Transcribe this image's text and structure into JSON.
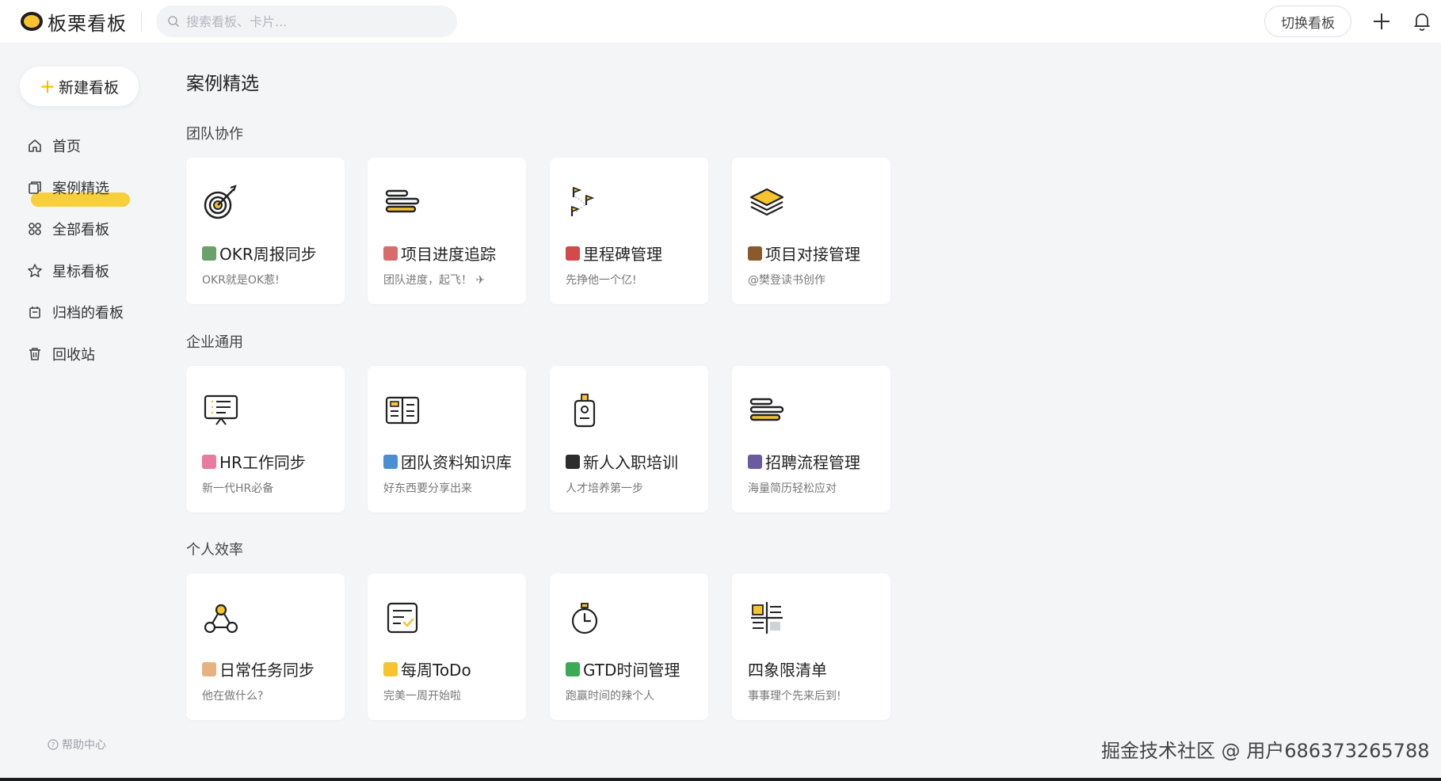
{
  "app": {
    "name": "板栗看板"
  },
  "search": {
    "placeholder": "搜索看板、卡片..."
  },
  "header": {
    "switch_board_label": "切换看板"
  },
  "sidebar": {
    "new_board_label": "新建看板",
    "items": [
      {
        "label": "首页",
        "icon": "home-icon"
      },
      {
        "label": "案例精选",
        "icon": "copy-icon",
        "active": true
      },
      {
        "label": "全部看板",
        "icon": "grid-icon"
      },
      {
        "label": "星标看板",
        "icon": "star-icon"
      },
      {
        "label": "归档的看板",
        "icon": "archive-icon"
      },
      {
        "label": "回收站",
        "icon": "trash-icon"
      }
    ],
    "help_label": "帮助中心"
  },
  "main": {
    "title": "案例精选",
    "sections": [
      {
        "title": "团队协作",
        "cards": [
          {
            "title": "OKR周报同步",
            "desc": "OKR就是OK惹!",
            "icon": "target-icon"
          },
          {
            "title": "项目进度追踪",
            "desc": "团队进度，起飞！ ✈",
            "icon": "progress-bars-icon"
          },
          {
            "title": "里程碑管理",
            "desc": "先挣他一个亿!",
            "icon": "milestone-flags-icon"
          },
          {
            "title": "项目对接管理",
            "desc": "@樊登读书创作",
            "icon": "layers-icon"
          }
        ]
      },
      {
        "title": "企业通用",
        "cards": [
          {
            "title": "HR工作同步",
            "desc": "新一代HR必备",
            "icon": "presentation-board-icon"
          },
          {
            "title": "团队资料知识库",
            "desc": "好东西要分享出来",
            "icon": "book-icon"
          },
          {
            "title": "新人入职培训",
            "desc": "人才培养第一步",
            "icon": "badge-icon"
          },
          {
            "title": "招聘流程管理",
            "desc": "海量简历轻松应对",
            "icon": "list-bars-icon"
          }
        ]
      },
      {
        "title": "个人效率",
        "cards": [
          {
            "title": "日常任务同步",
            "desc": "他在做什么?",
            "icon": "network-triangle-icon"
          },
          {
            "title": "每周ToDo",
            "desc": "完美一周开始啦",
            "icon": "checklist-icon"
          },
          {
            "title": "GTD时间管理",
            "desc": "跑赢时间的辣个人",
            "icon": "stopwatch-icon"
          },
          {
            "title": "四象限清单",
            "desc": "事事理个先来后到!",
            "icon": "quadrant-icon"
          }
        ]
      }
    ]
  },
  "watermark": "掘金技术社区 @ 用户686373265788",
  "colors": {
    "accent": "#f7c42f",
    "background": "#f4f5f7",
    "card": "#ffffff"
  }
}
